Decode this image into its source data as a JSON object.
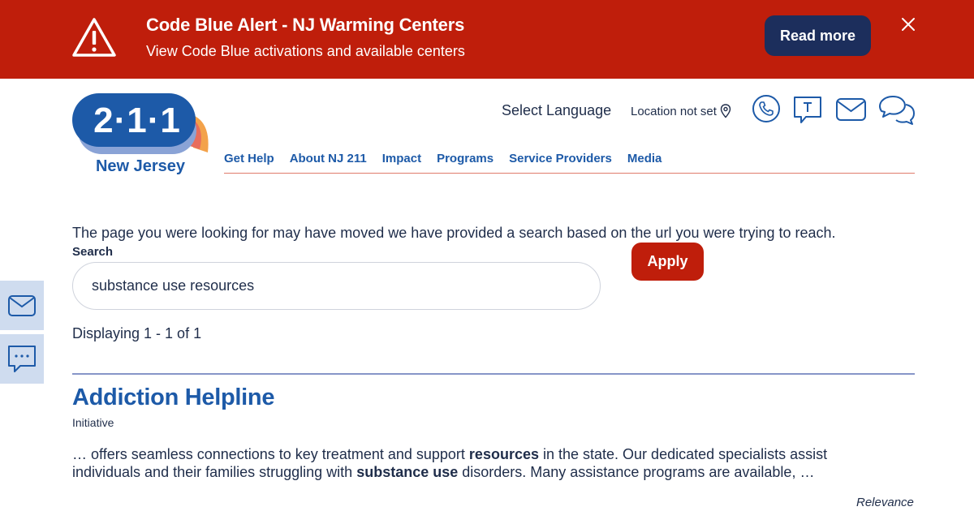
{
  "alert": {
    "title": "Code Blue Alert - NJ Warming Centers",
    "subtitle": "View Code Blue activations and available centers",
    "button_label": "Read more",
    "icon": "warning-triangle-icon",
    "close_icon": "close-icon"
  },
  "logo": {
    "number": "2·1·1",
    "text": "New Jersey"
  },
  "header": {
    "select_language": "Select Language",
    "location": "Location not set",
    "icons": [
      "phone-icon",
      "text-icon",
      "email-icon",
      "chat-icon"
    ]
  },
  "nav": {
    "items": [
      "Get Help",
      "About NJ 211",
      "Impact",
      "Programs",
      "Service Providers",
      "Media"
    ]
  },
  "main": {
    "notice": "The page you were looking for may have moved we have provided a search based on the url you were trying to reach.",
    "search_label": "Search",
    "search_value": "substance use resources",
    "apply_label": "Apply",
    "display_count": "Displaying 1 - 1 of 1"
  },
  "result": {
    "title": "Addiction Helpline",
    "type": "Initiative",
    "snippet_parts": [
      "… offers seamless connections to key treatment and support ",
      "resources",
      " in the state. Our dedicated specialists assist individuals and their families struggling with ",
      "substance use",
      " disorders. Many assistance programs are available, …"
    ],
    "relevance": "Relevance"
  },
  "colors": {
    "alert_bg": "#bf1e0b",
    "read_more_bg": "#1c2e5c",
    "brand_blue": "#1d5aa8",
    "side_btn_bg": "#cfdcef"
  },
  "side_buttons": [
    "email-icon",
    "chat-icon"
  ]
}
